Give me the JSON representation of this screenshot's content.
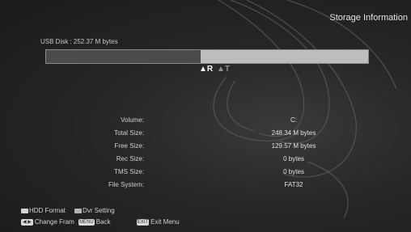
{
  "header": {
    "title": "Storage Information"
  },
  "disk": {
    "label": "USB Disk : 252.37 M bytes",
    "used_fraction": 0.48
  },
  "markers": {
    "r": "R",
    "t": "T"
  },
  "info": [
    {
      "label": "Volume:",
      "value": "C:"
    },
    {
      "label": "Total Size:",
      "value": "248.34 M bytes"
    },
    {
      "label": "Free Size:",
      "value": "129.57 M bytes"
    },
    {
      "label": "Rec Size:",
      "value": "0 bytes"
    },
    {
      "label": "TMS Size:",
      "value": "0 bytes"
    },
    {
      "label": "File System:",
      "value": "FAT32"
    }
  ],
  "footer": {
    "hdd_format": "HDD Format",
    "dvr_setting": "Dvr Setting",
    "change_frame": "Change Fram",
    "menu_key": "MENU",
    "back": "Back",
    "exit_key": "EXIT",
    "exit_menu": "Exit Menu"
  },
  "colors": {
    "background": "#262626",
    "bar_used": "#4b4b4b",
    "bar_free": "#bdbdbd"
  }
}
